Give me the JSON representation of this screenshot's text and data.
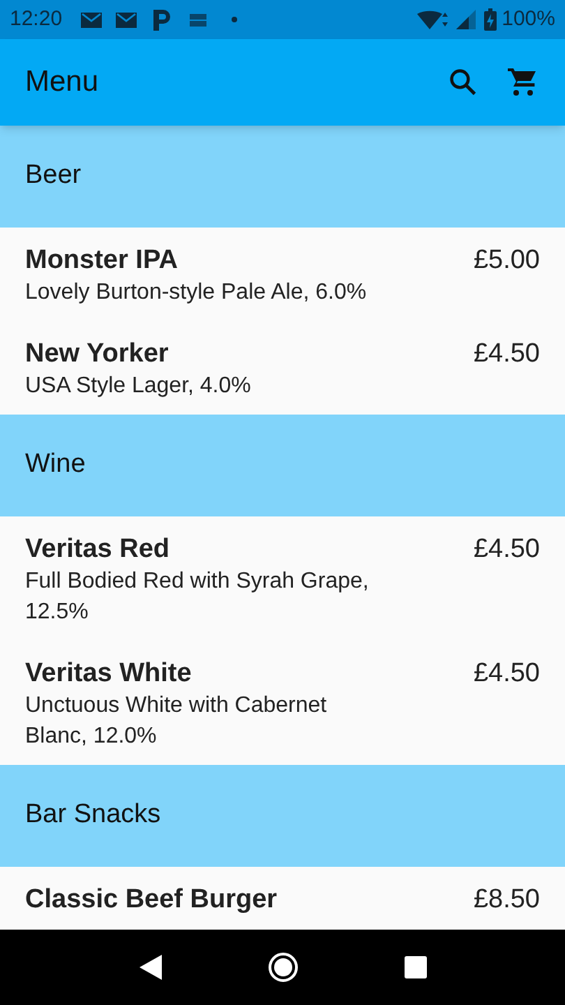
{
  "status_bar": {
    "time": "12:20",
    "battery": "100%"
  },
  "app_bar": {
    "title": "Menu"
  },
  "sections": [
    {
      "title": "Beer",
      "items": [
        {
          "name": "Monster IPA",
          "description": "Lovely Burton-style Pale Ale, 6.0%",
          "price": "£5.00"
        },
        {
          "name": "New Yorker",
          "description": "USA Style Lager, 4.0%",
          "price": "£4.50"
        }
      ]
    },
    {
      "title": "Wine",
      "items": [
        {
          "name": "Veritas Red",
          "description": "Full Bodied Red with Syrah Grape, 12.5%",
          "price": "£4.50"
        },
        {
          "name": "Veritas White",
          "description": "Unctuous White with Cabernet Blanc, 12.0%",
          "price": "£4.50"
        }
      ]
    },
    {
      "title": "Bar Snacks",
      "items": [
        {
          "name": "Classic Beef Burger",
          "price": "£8.50"
        }
      ]
    }
  ]
}
